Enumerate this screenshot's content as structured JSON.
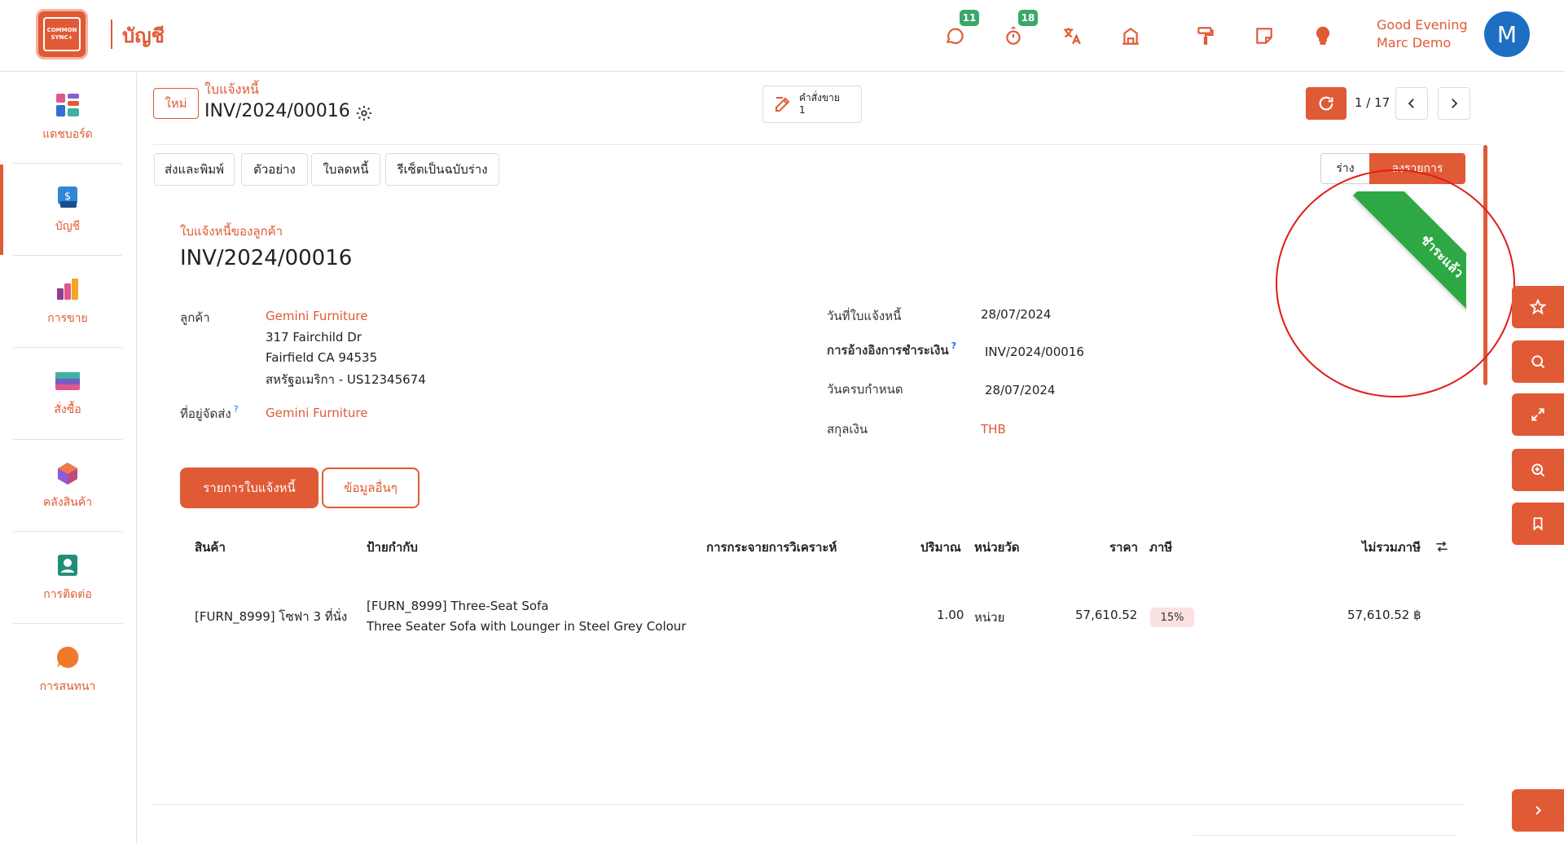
{
  "app": {
    "logo_line1": "COMMON",
    "logo_line2": "SYNC+",
    "title": "บัญชี"
  },
  "topbar": {
    "chat_badge": "11",
    "timer_badge": "18",
    "greeting_line1": "Good Evening",
    "greeting_line2": "Marc Demo",
    "avatar_letter": "M"
  },
  "sidebar": {
    "items": [
      {
        "label": "แดชบอร์ด",
        "icon": "dashboard-icon"
      },
      {
        "label": "บัญชี",
        "icon": "accounting-icon"
      },
      {
        "label": "การขาย",
        "icon": "sales-icon"
      },
      {
        "label": "สั่งซื้อ",
        "icon": "purchase-icon"
      },
      {
        "label": "คลังสินค้า",
        "icon": "inventory-icon"
      },
      {
        "label": "การติดต่อ",
        "icon": "contacts-icon"
      },
      {
        "label": "การสนทนา",
        "icon": "discuss-icon"
      }
    ]
  },
  "header": {
    "new_label": "ใหม่",
    "breadcrumb_parent": "ใบแจ้งหนี้",
    "record_title": "INV/2024/00016",
    "smart_button_label": "คำสั่งขาย",
    "smart_button_count": "1",
    "pager": "1 / 17"
  },
  "actions": {
    "send_print": "ส่งและพิมพ์",
    "preview": "ตัวอย่าง",
    "credit_note": "ใบลดหนี้",
    "reset_draft": "รีเซ็ตเป็นฉบับร่าง",
    "status_draft": "ร่าง",
    "status_posted": "ลงรายการ"
  },
  "ribbon": {
    "text": "ชำระแล้ว"
  },
  "document": {
    "subtitle": "ใบแจ้งหนี้ของลูกค้า",
    "title": "INV/2024/00016",
    "customer_label": "ลูกค้า",
    "customer_name": "Gemini Furniture",
    "address_line1": "317 Fairchild Dr",
    "address_line2": "Fairfield CA 94535",
    "address_line3": "สหรัฐอเมริกา - US12345674",
    "delivery_label": "ที่อยู่จัดส่ง",
    "delivery_value": "Gemini Furniture",
    "invoice_date_label": "วันที่ใบแจ้งหนี้",
    "invoice_date": "28/07/2024",
    "payment_ref_label": "การอ้างอิงการชำระเงิน",
    "payment_ref": "INV/2024/00016",
    "due_date_label": "วันครบกำหนด",
    "due_date": "28/07/2024",
    "currency_label": "สกุลเงิน",
    "currency": "THB",
    "help_mark": "?"
  },
  "tabs": {
    "lines": "รายการใบแจ้งหนี้",
    "other": "ข้อมูลอื่นๆ"
  },
  "table": {
    "headers": {
      "product": "สินค้า",
      "label": "ป้ายกำกับ",
      "analytic": "การกระจายการวิเคราะห์",
      "quantity": "ปริมาณ",
      "uom": "หน่วยวัด",
      "price": "ราคา",
      "tax": "ภาษี",
      "subtotal": "ไม่รวมภาษี"
    },
    "rows": [
      {
        "product": "[FURN_8999] โซฟา 3 ที่นั่ง",
        "label_line1": "[FURN_8999] Three-Seat Sofa",
        "label_line2": "Three Seater Sofa with Lounger in Steel Grey Colour",
        "quantity": "1.00",
        "uom": "หน่วย",
        "price": "57,610.52",
        "tax": "15%",
        "subtotal": "57,610.52 ฿"
      }
    ]
  },
  "colors": {
    "accent": "#e05a35",
    "ribbon": "#2da844",
    "badge": "#3aa86a",
    "avatar": "#1c6fc2"
  }
}
